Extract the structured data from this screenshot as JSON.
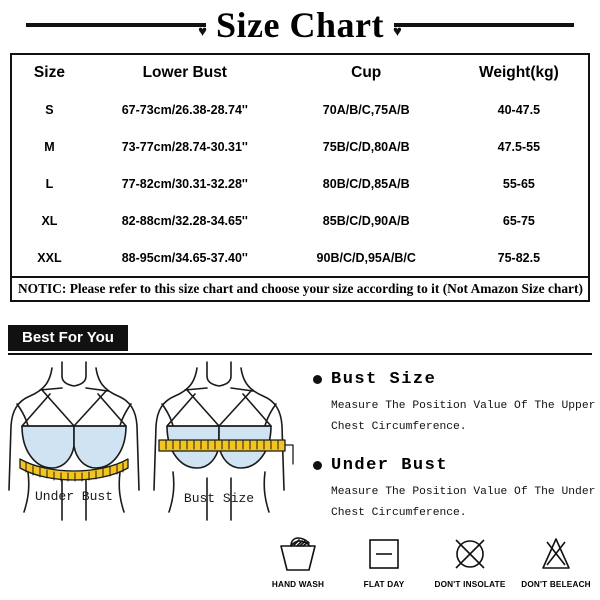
{
  "title": {
    "text": "Size Chart",
    "heart_glyph": "♥"
  },
  "size_table": {
    "headers": [
      "Size",
      "Lower Bust",
      "Cup",
      "Weight(kg)"
    ],
    "rows": [
      [
        "S",
        "67-73cm/26.38-28.74''",
        "70A/B/C,75A/B",
        "40-47.5"
      ],
      [
        "M",
        "73-77cm/28.74-30.31''",
        "75B/C/D,80A/B",
        "47.5-55"
      ],
      [
        "L",
        "77-82cm/30.31-32.28''",
        "80B/C/D,85A/B",
        "55-65"
      ],
      [
        "XL",
        "82-88cm/32.28-34.65''",
        "85B/C/D,90A/B",
        "65-75"
      ],
      [
        "XXL",
        "88-95cm/34.65-37.40''",
        "90B/C/D,95A/B/C",
        "75-82.5"
      ]
    ],
    "notice": "NOTIC: Please refer to this size chart and choose your size according to it (Not Amazon Size chart)"
  },
  "banner": {
    "label": "Best For You"
  },
  "illustration": {
    "left_label": "Under Bust",
    "right_label": "Bust Size",
    "bra_color": "#cfe3f2",
    "tape_color": "#f2c521",
    "outline_color": "#1a1a1a"
  },
  "info_panel": {
    "items": [
      {
        "heading": "Bust Size",
        "line1": "Measure The Position Value Of The Upper",
        "line2": "Chest Circumference."
      },
      {
        "heading": "Under Bust",
        "line1": "Measure The Position Value Of The Under",
        "line2": "Chest Circumference."
      }
    ]
  },
  "care_icons": [
    {
      "name": "hand-wash-icon",
      "label": "HAND WASH"
    },
    {
      "name": "flat-dry-icon",
      "label": "FLAT DAY"
    },
    {
      "name": "no-insolate-icon",
      "label": "DON'T INSOLATE"
    },
    {
      "name": "no-bleach-icon",
      "label": "DON'T BELEACH"
    }
  ]
}
